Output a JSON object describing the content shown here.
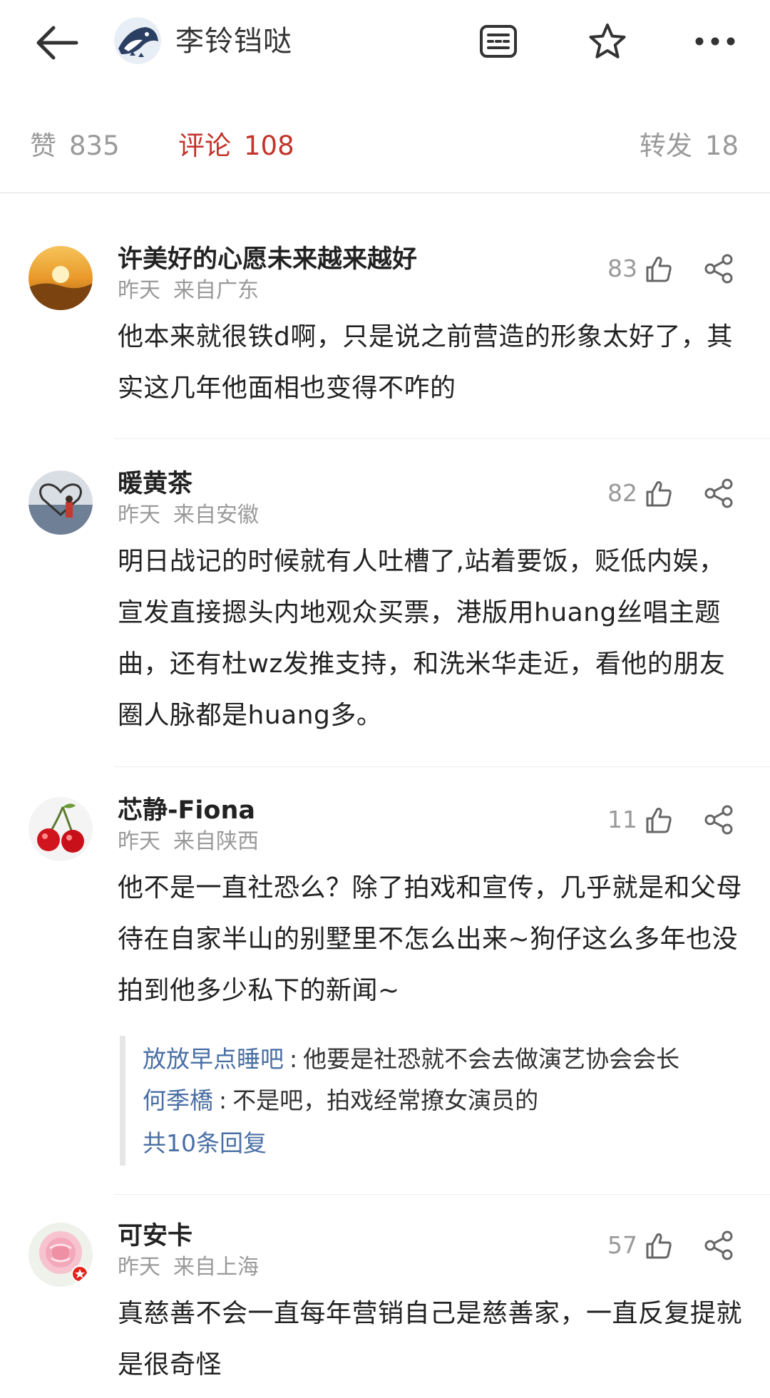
{
  "header": {
    "poster_name": "李铃铛哒",
    "back_icon": "arrow-left-icon",
    "doc_icon": "article-icon",
    "star_icon": "star-outline-icon",
    "more_icon": "more-dots-icon"
  },
  "stats": {
    "like_label": "赞",
    "like_count": "835",
    "comment_label": "评论",
    "comment_count": "108",
    "repost_label": "转发",
    "repost_count": "18",
    "active_color": "#c2342c"
  },
  "comments": [
    {
      "username": "许美好的心愿未来越来越好",
      "time": "昨天",
      "location": "来自广东",
      "likes": "83",
      "body": "他本来就很铁d啊，只是说之前营造的形象太好了，其实这几年他面相也变得不咋的"
    },
    {
      "username": "暖黄茶",
      "time": "昨天",
      "location": "来自安徽",
      "likes": "82",
      "body": "明日战记的时候就有人吐槽了,站着要饭，贬低内娱，宣发直接摁头内地观众买票，港版用huang丝唱主题曲，还有杜wz发推支持，和洗米华走近，看他的朋友圈人脉都是huang多。"
    },
    {
      "username": "芯静-Fiona",
      "time": "昨天",
      "location": "来自陕西",
      "likes": "11",
      "body": "他不是一直社恐么？除了拍戏和宣传，几乎就是和父母待在自家半山的别墅里不怎么出来~狗仔这么多年也没拍到他多少私下的新闻~",
      "replies": [
        {
          "name": "放放早点睡吧",
          "text": "他要是社恐就不会去做演艺协会会长"
        },
        {
          "name": "何季橋",
          "text": "不是吧，拍戏经常撩女演员的"
        }
      ],
      "more_replies": "共10条回复"
    },
    {
      "username": "可安卡",
      "time": "昨天",
      "location": "来自上海",
      "likes": "57",
      "body": "真慈善不会一直每年营销自己是慈善家，一直反复提就是很奇怪"
    }
  ],
  "icons": {
    "like": "thumbs-up-icon",
    "share": "share-icon"
  },
  "colors": {
    "link_blue": "#4a6fa5",
    "muted_gray": "#9a9a9a"
  }
}
